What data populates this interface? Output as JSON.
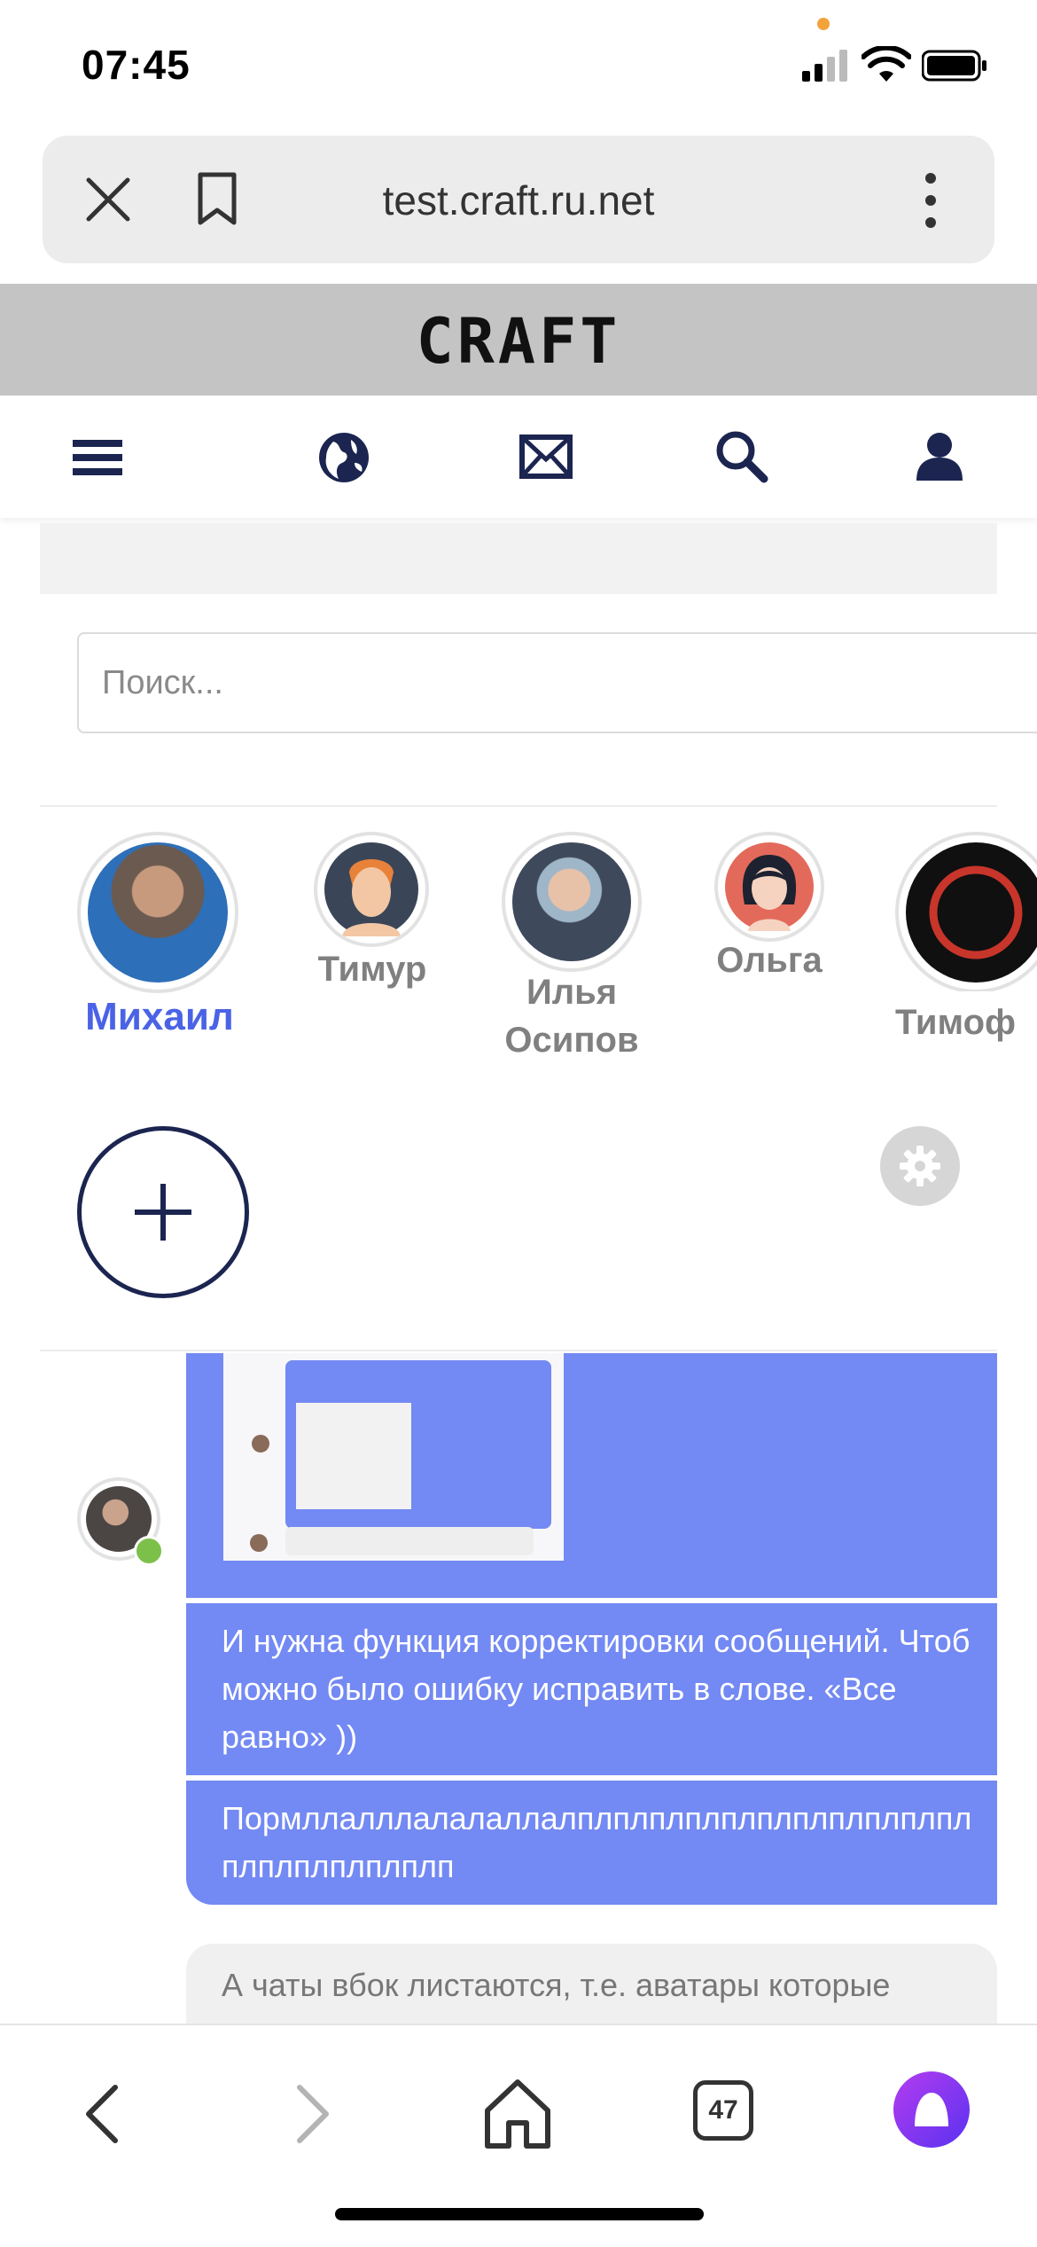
{
  "status": {
    "time": "07:45"
  },
  "browser": {
    "url": "test.craft.ru.net",
    "tab_count": "47"
  },
  "site": {
    "logo": "CRAFT"
  },
  "search": {
    "placeholder": "Поиск..."
  },
  "contacts": [
    {
      "name": "Михаил",
      "active": true
    },
    {
      "name": "Тимур",
      "active": false
    },
    {
      "name": "Илья Осипов",
      "active": false
    },
    {
      "name": "Ольга",
      "active": false
    },
    {
      "name": "Тимоф",
      "active": false
    }
  ],
  "messages": [
    {
      "text": "И нужна функция корректировки сообщений. Чтоб можно было ошибку исправить в слове. «Все равно» ))"
    },
    {
      "text": "Пормллалллалалаллалплплплплплплплплплплплплплплплплплп"
    },
    {
      "text": "А чаты вбок листаются, т.е. аватары которые"
    }
  ],
  "colors": {
    "accent": "#4a63e6",
    "bubble": "#7389f3",
    "nav_icon": "#1b2550",
    "online": "#7cc04a",
    "banner": "#c4c4c4"
  }
}
